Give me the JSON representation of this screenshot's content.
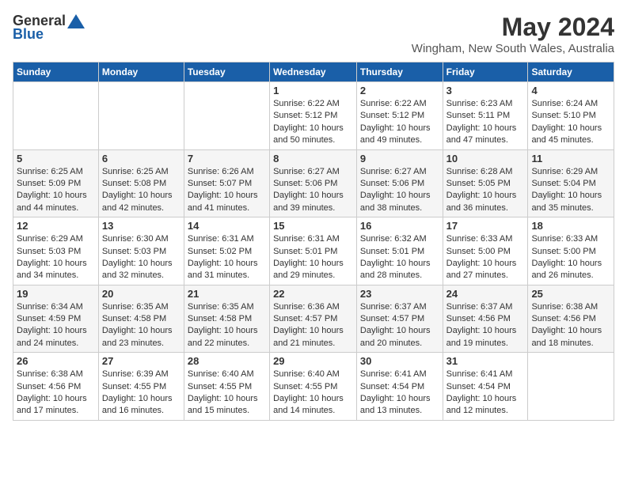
{
  "header": {
    "logo_general": "General",
    "logo_blue": "Blue",
    "month_title": "May 2024",
    "location": "Wingham, New South Wales, Australia"
  },
  "weekdays": [
    "Sunday",
    "Monday",
    "Tuesday",
    "Wednesday",
    "Thursday",
    "Friday",
    "Saturday"
  ],
  "weeks": [
    [
      {
        "day": "",
        "info": ""
      },
      {
        "day": "",
        "info": ""
      },
      {
        "day": "",
        "info": ""
      },
      {
        "day": "1",
        "info": "Sunrise: 6:22 AM\nSunset: 5:12 PM\nDaylight: 10 hours\nand 50 minutes."
      },
      {
        "day": "2",
        "info": "Sunrise: 6:22 AM\nSunset: 5:12 PM\nDaylight: 10 hours\nand 49 minutes."
      },
      {
        "day": "3",
        "info": "Sunrise: 6:23 AM\nSunset: 5:11 PM\nDaylight: 10 hours\nand 47 minutes."
      },
      {
        "day": "4",
        "info": "Sunrise: 6:24 AM\nSunset: 5:10 PM\nDaylight: 10 hours\nand 45 minutes."
      }
    ],
    [
      {
        "day": "5",
        "info": "Sunrise: 6:25 AM\nSunset: 5:09 PM\nDaylight: 10 hours\nand 44 minutes."
      },
      {
        "day": "6",
        "info": "Sunrise: 6:25 AM\nSunset: 5:08 PM\nDaylight: 10 hours\nand 42 minutes."
      },
      {
        "day": "7",
        "info": "Sunrise: 6:26 AM\nSunset: 5:07 PM\nDaylight: 10 hours\nand 41 minutes."
      },
      {
        "day": "8",
        "info": "Sunrise: 6:27 AM\nSunset: 5:06 PM\nDaylight: 10 hours\nand 39 minutes."
      },
      {
        "day": "9",
        "info": "Sunrise: 6:27 AM\nSunset: 5:06 PM\nDaylight: 10 hours\nand 38 minutes."
      },
      {
        "day": "10",
        "info": "Sunrise: 6:28 AM\nSunset: 5:05 PM\nDaylight: 10 hours\nand 36 minutes."
      },
      {
        "day": "11",
        "info": "Sunrise: 6:29 AM\nSunset: 5:04 PM\nDaylight: 10 hours\nand 35 minutes."
      }
    ],
    [
      {
        "day": "12",
        "info": "Sunrise: 6:29 AM\nSunset: 5:03 PM\nDaylight: 10 hours\nand 34 minutes."
      },
      {
        "day": "13",
        "info": "Sunrise: 6:30 AM\nSunset: 5:03 PM\nDaylight: 10 hours\nand 32 minutes."
      },
      {
        "day": "14",
        "info": "Sunrise: 6:31 AM\nSunset: 5:02 PM\nDaylight: 10 hours\nand 31 minutes."
      },
      {
        "day": "15",
        "info": "Sunrise: 6:31 AM\nSunset: 5:01 PM\nDaylight: 10 hours\nand 29 minutes."
      },
      {
        "day": "16",
        "info": "Sunrise: 6:32 AM\nSunset: 5:01 PM\nDaylight: 10 hours\nand 28 minutes."
      },
      {
        "day": "17",
        "info": "Sunrise: 6:33 AM\nSunset: 5:00 PM\nDaylight: 10 hours\nand 27 minutes."
      },
      {
        "day": "18",
        "info": "Sunrise: 6:33 AM\nSunset: 5:00 PM\nDaylight: 10 hours\nand 26 minutes."
      }
    ],
    [
      {
        "day": "19",
        "info": "Sunrise: 6:34 AM\nSunset: 4:59 PM\nDaylight: 10 hours\nand 24 minutes."
      },
      {
        "day": "20",
        "info": "Sunrise: 6:35 AM\nSunset: 4:58 PM\nDaylight: 10 hours\nand 23 minutes."
      },
      {
        "day": "21",
        "info": "Sunrise: 6:35 AM\nSunset: 4:58 PM\nDaylight: 10 hours\nand 22 minutes."
      },
      {
        "day": "22",
        "info": "Sunrise: 6:36 AM\nSunset: 4:57 PM\nDaylight: 10 hours\nand 21 minutes."
      },
      {
        "day": "23",
        "info": "Sunrise: 6:37 AM\nSunset: 4:57 PM\nDaylight: 10 hours\nand 20 minutes."
      },
      {
        "day": "24",
        "info": "Sunrise: 6:37 AM\nSunset: 4:56 PM\nDaylight: 10 hours\nand 19 minutes."
      },
      {
        "day": "25",
        "info": "Sunrise: 6:38 AM\nSunset: 4:56 PM\nDaylight: 10 hours\nand 18 minutes."
      }
    ],
    [
      {
        "day": "26",
        "info": "Sunrise: 6:38 AM\nSunset: 4:56 PM\nDaylight: 10 hours\nand 17 minutes."
      },
      {
        "day": "27",
        "info": "Sunrise: 6:39 AM\nSunset: 4:55 PM\nDaylight: 10 hours\nand 16 minutes."
      },
      {
        "day": "28",
        "info": "Sunrise: 6:40 AM\nSunset: 4:55 PM\nDaylight: 10 hours\nand 15 minutes."
      },
      {
        "day": "29",
        "info": "Sunrise: 6:40 AM\nSunset: 4:55 PM\nDaylight: 10 hours\nand 14 minutes."
      },
      {
        "day": "30",
        "info": "Sunrise: 6:41 AM\nSunset: 4:54 PM\nDaylight: 10 hours\nand 13 minutes."
      },
      {
        "day": "31",
        "info": "Sunrise: 6:41 AM\nSunset: 4:54 PM\nDaylight: 10 hours\nand 12 minutes."
      },
      {
        "day": "",
        "info": ""
      }
    ]
  ]
}
